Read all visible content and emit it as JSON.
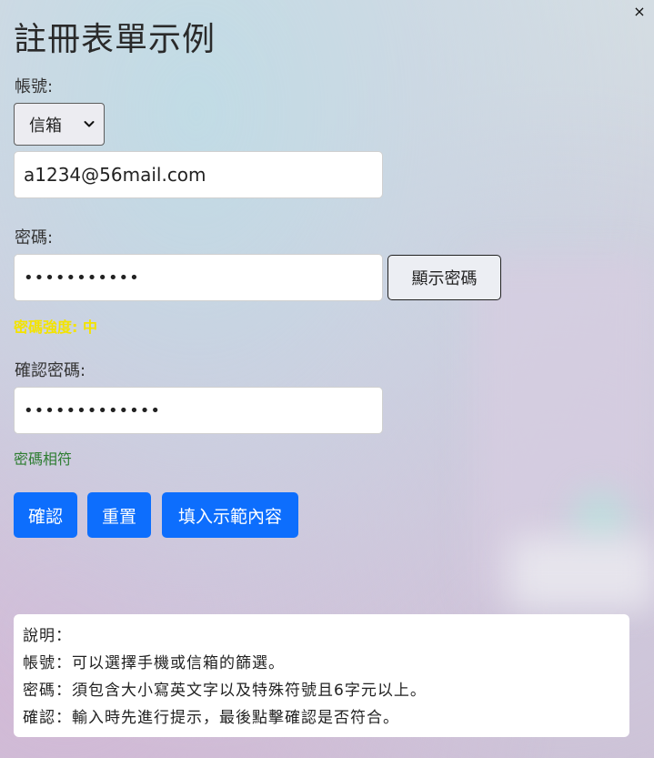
{
  "window": {
    "close_symbol": "×"
  },
  "form": {
    "title": "註冊表單示例",
    "account": {
      "label": "帳號:",
      "select_value": "信箱",
      "input_value": "a1234@56mail.com"
    },
    "password": {
      "label": "密碼:",
      "masked_value": "•••••••••••",
      "show_button": "顯示密碼",
      "strength_text": "密碼強度: 中"
    },
    "confirm": {
      "label": "確認密碼:",
      "masked_value": "•••••••••••••",
      "match_text": "密碼相符"
    },
    "buttons": {
      "confirm": "確認",
      "reset": "重置",
      "fill_demo": "填入示範內容"
    }
  },
  "notes": {
    "heading": "說明：",
    "lines": [
      "帳號：可以選擇手機或信箱的篩選。",
      "密碼：須包含大小寫英文字以及特殊符號且6字元以上。",
      "確認：輸入時先進行提示，最後點擊確認是否符合。"
    ]
  },
  "icons": {
    "select_arrow": "chevron-down-icon",
    "close": "close-icon"
  },
  "colors": {
    "primary_button": "#0d6efd",
    "strength_medium": "#f3e300",
    "match_ok": "#2e7d32"
  }
}
